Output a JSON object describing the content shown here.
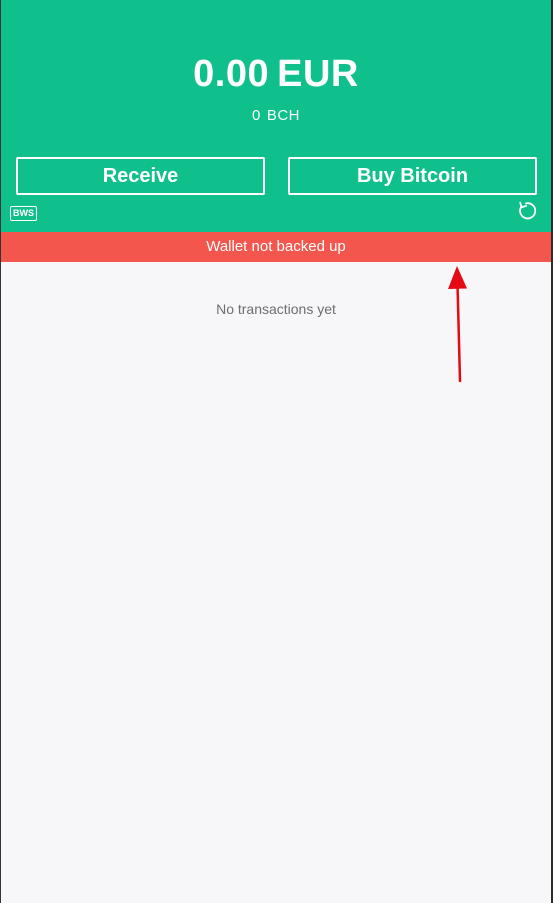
{
  "balance": {
    "amount": "0.00",
    "currency": "EUR",
    "crypto_amount": "0",
    "crypto_unit": "BCH"
  },
  "actions": {
    "receive_label": "Receive",
    "buy_label": "Buy Bitcoin"
  },
  "bws_badge": "BWS",
  "icons": {
    "refresh": "refresh-icon"
  },
  "warning": {
    "text": "Wallet not backed up"
  },
  "transactions": {
    "empty_text": "No transactions yet"
  },
  "colors": {
    "header_bg": "#0fc08d",
    "warning_bg": "#f3564c",
    "content_bg": "#f7f7f9",
    "annotation_arrow": "#e50914"
  }
}
